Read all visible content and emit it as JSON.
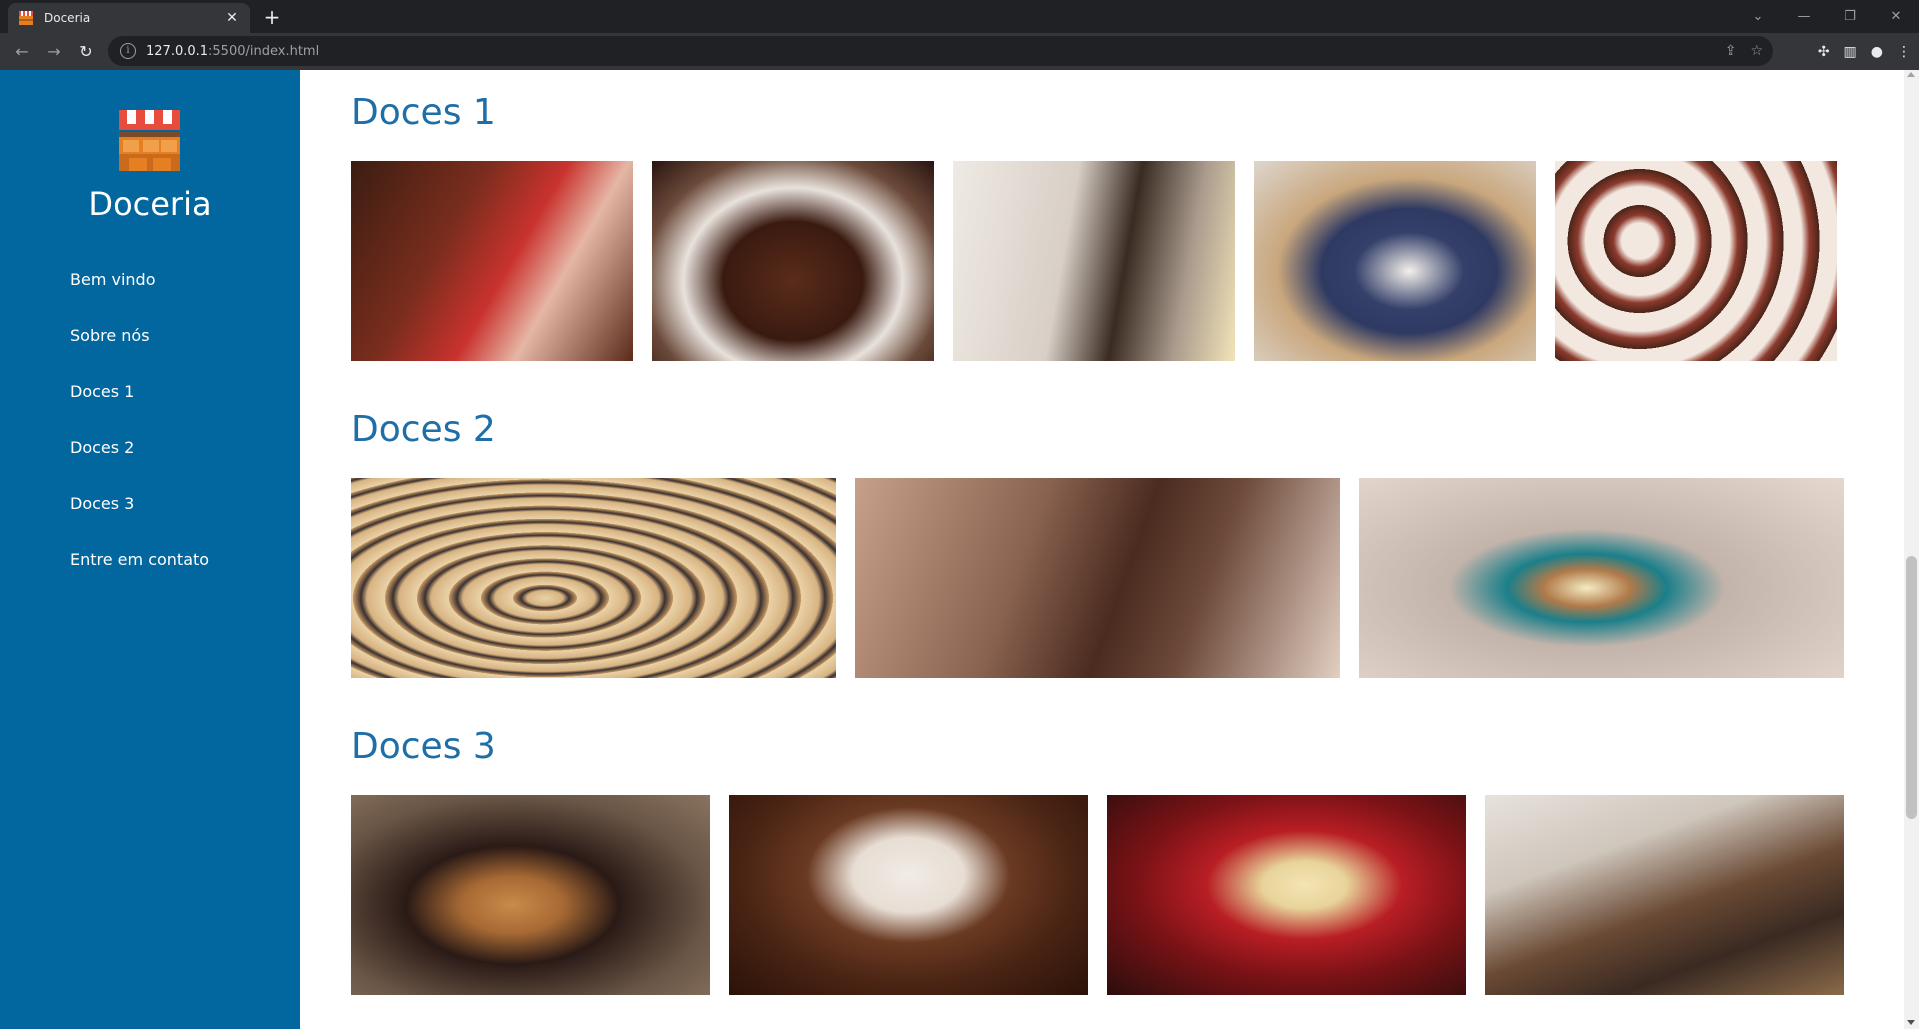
{
  "browser": {
    "tab_title": "Doceria",
    "url_host": "127.0.0.1",
    "url_path": ":5500/index.html"
  },
  "sidebar": {
    "brand": "Doceria",
    "nav": [
      {
        "label": "Bem vindo"
      },
      {
        "label": "Sobre nós"
      },
      {
        "label": "Doces 1"
      },
      {
        "label": "Doces 2"
      },
      {
        "label": "Doces 3"
      },
      {
        "label": "Entre em contato"
      }
    ]
  },
  "sections": [
    {
      "title": "Doces 1",
      "photos": [
        "candy-jars",
        "chocolate-cake",
        "chef-decorating",
        "blueberry-tarts",
        "cupcakes"
      ]
    },
    {
      "title": "Doces 2",
      "photos": [
        "poppy-seed-rolls",
        "chocolate-cake-slice",
        "cupcake-in-hand"
      ]
    },
    {
      "title": "Doces 3",
      "photos": [
        "pancakes-raspberries",
        "coconut-chocolate-dessert",
        "christmas-cream-desserts",
        "pastry-display"
      ]
    }
  ],
  "colors": {
    "sidebar": "#02669f",
    "heading": "#1e6ea7"
  }
}
